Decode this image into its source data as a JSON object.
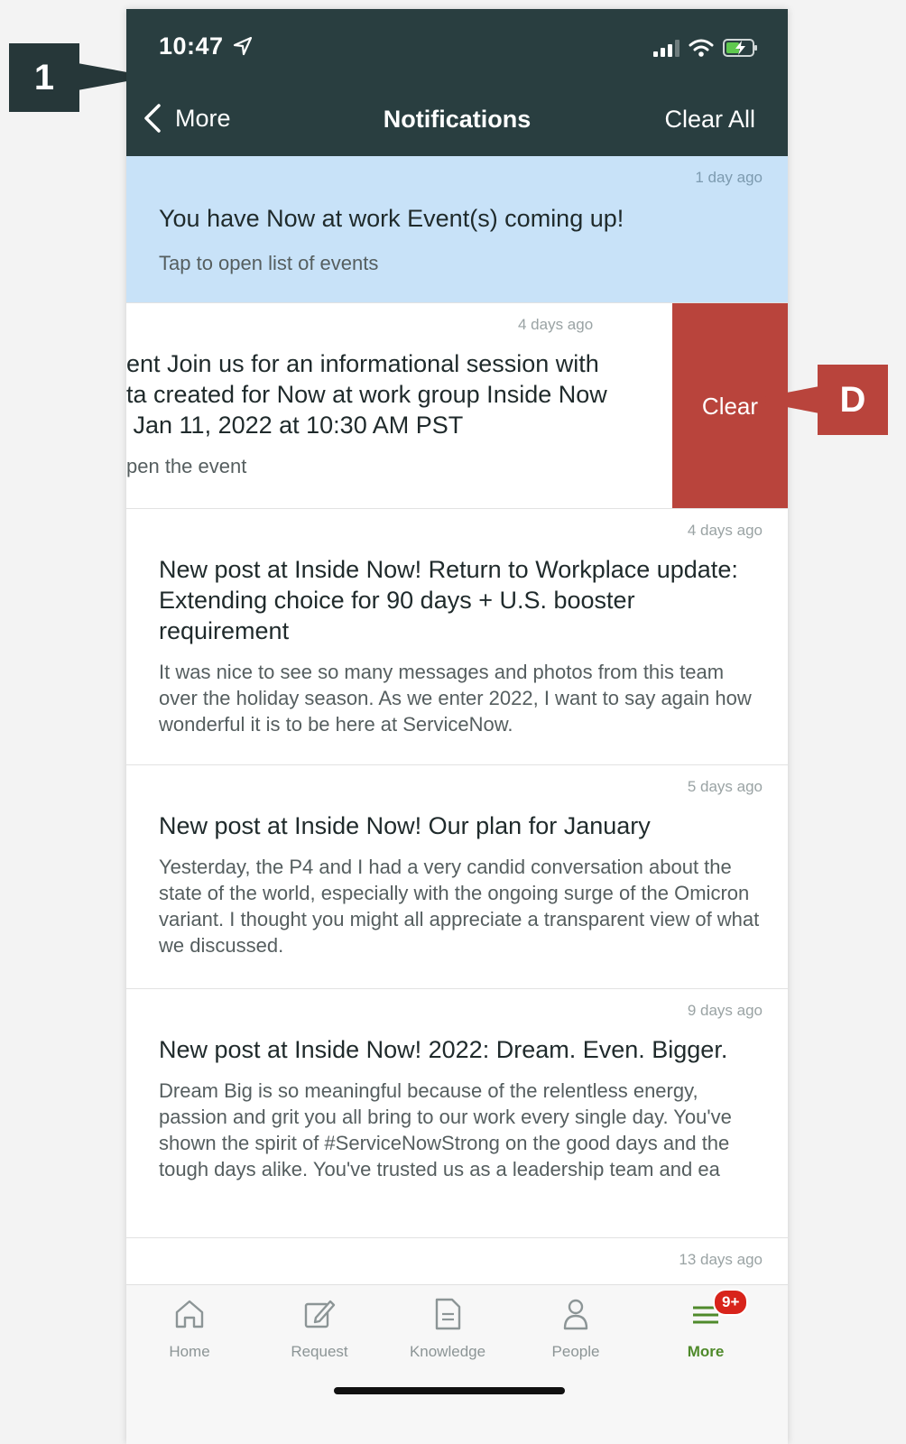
{
  "status_bar": {
    "time": "10:47"
  },
  "nav": {
    "back_label": "More",
    "title": "Notifications",
    "clear_all": "Clear All"
  },
  "notifications": [
    {
      "time": "1 day ago",
      "title": "You have Now at work Event(s) coming up!",
      "body": "Tap to open list of events"
    },
    {
      "time": "4 days ago",
      "title": "ent Join us for an informational session with ta created for Now at work group Inside Now Jan 11, 2022 at 10:30 AM PST",
      "title_lines": [
        "ent Join us for an informational session with",
        "ta created for Now at work group Inside Now",
        " Jan 11, 2022 at 10:30 AM PST"
      ],
      "body": "pen the event",
      "swipe_action": "Clear"
    },
    {
      "time": "4 days ago",
      "title": "New post at Inside Now! Return to Workplace update: Extending choice for 90 days + U.S. booster requirement",
      "body": "It was nice to see so many messages and photos from this team over the holiday season. As we enter 2022, I want to say again how wonderful it is to be here at ServiceNow."
    },
    {
      "time": "5 days ago",
      "title": "New post at Inside Now! Our plan for January",
      "body": "Yesterday, the P4 and I had a very candid conversation about the state of the world, especially with the ongoing surge of the Omicron variant. I thought you might all appreciate a transparent view of what we discussed."
    },
    {
      "time": "9 days ago",
      "title": "New post at Inside Now! 2022: Dream. Even. Bigger.",
      "body": "Dream Big is so meaningful because of the relentless energy, passion and grit you all bring to our work every single day. You've shown the spirit of #ServiceNowStrong on the good days and the tough days alike. You've trusted us as a leadership team and ea"
    },
    {
      "time": "13 days ago"
    }
  ],
  "tabs": [
    {
      "label": "Home",
      "icon": "home-icon"
    },
    {
      "label": "Request",
      "icon": "edit-icon"
    },
    {
      "label": "Knowledge",
      "icon": "document-icon"
    },
    {
      "label": "People",
      "icon": "person-icon"
    },
    {
      "label": "More",
      "icon": "menu-icon",
      "badge": "9+",
      "active": true
    }
  ],
  "callouts": {
    "one": "1",
    "d": "D"
  },
  "colors": {
    "header": "#293e40",
    "highlight": "#c8e2f8",
    "clear": "#b9443c",
    "active_tab": "#4f8a2b",
    "badge": "#d8241b"
  }
}
